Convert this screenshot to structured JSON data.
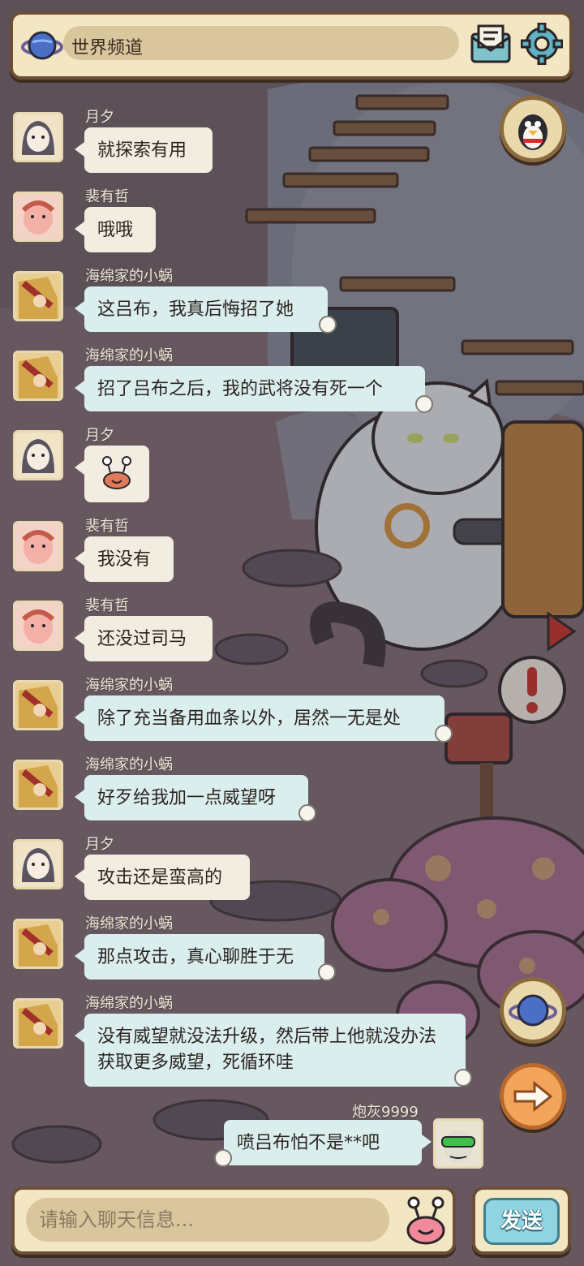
{
  "header": {
    "title": "世界频道"
  },
  "messages": [
    {
      "user": "月夕",
      "text": "就探索有用",
      "avatar": "moon"
    },
    {
      "user": "裴有哲",
      "text": "哦哦",
      "avatar": "pei"
    },
    {
      "user": "海绵家的小蜗",
      "text": "这吕布，我真后悔招了她",
      "avatar": "snail"
    },
    {
      "user": "海绵家的小蜗",
      "text": "招了吕布之后，我的武将没有死一个",
      "avatar": "snail"
    },
    {
      "user": "月夕",
      "text": "",
      "avatar": "moon"
    },
    {
      "user": "裴有哲",
      "text": "我没有",
      "avatar": "pei"
    },
    {
      "user": "裴有哲",
      "text": "还没过司马",
      "avatar": "pei"
    },
    {
      "user": "海绵家的小蜗",
      "text": "除了充当备用血条以外，居然一无是处",
      "avatar": "snail"
    },
    {
      "user": "海绵家的小蜗",
      "text": "好歹给我加一点威望呀",
      "avatar": "snail"
    },
    {
      "user": "月夕",
      "text": "攻击还是蛮高的",
      "avatar": "moon"
    },
    {
      "user": "海绵家的小蜗",
      "text": "那点攻击，真心聊胜于无",
      "avatar": "snail"
    },
    {
      "user": "海绵家的小蜗",
      "text": "没有威望就没法升级，然后带上他就没办法获取更多威望，死循环哇",
      "avatar": "snail"
    },
    {
      "user": "炮灰9999",
      "text": "喷吕布怕不是**吧",
      "avatar": "ash"
    }
  ],
  "input": {
    "placeholder": "请输入聊天信息..."
  },
  "send": {
    "label": "发送"
  },
  "colors": {
    "panel": "#f3e6c3",
    "border": "#6b4e36",
    "bubble": "#f2ede0",
    "bubble_teal": "#dbeeee",
    "send": "#8fd4e0"
  }
}
